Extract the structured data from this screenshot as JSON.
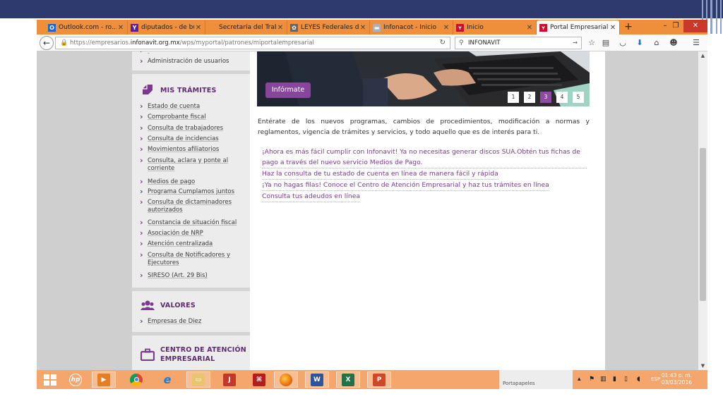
{
  "browser": {
    "tabs": [
      {
        "label": "Outlook.com - ro...",
        "favicon": "outlook-icon",
        "color": "#1e64c8",
        "glyph": "O"
      },
      {
        "label": "diputados - de bú...",
        "favicon": "yahoo-icon",
        "color": "#5a1f9e",
        "glyph": "Y"
      },
      {
        "label": "Secretaría del Trabajo ...",
        "favicon": "none",
        "color": "",
        "glyph": ""
      },
      {
        "label": "LEYES Federales d...",
        "favicon": "seal-icon",
        "color": "#666666",
        "glyph": "✿"
      },
      {
        "label": "Infonacot - Inicio",
        "favicon": "infonacot-icon",
        "color": "#b0b0b0",
        "glyph": "▬"
      },
      {
        "label": "Inicio",
        "favicon": "infonavit-icon",
        "color": "#c8102e",
        "glyph": "ʏ"
      },
      {
        "label": "Portal Empresarial",
        "favicon": "infonavit-icon",
        "color": "#c8102e",
        "glyph": "ʏ",
        "active": true
      }
    ],
    "close_glyph": "✕",
    "new_tab_glyph": "+",
    "window_controls": {
      "minimize": "–",
      "restore": "❐",
      "close": "✕"
    },
    "url_prefix": "https://empresarios.",
    "url_host": "infonavit.org.mx",
    "url_path": "/wps/myportal/patrones/miportalempresarial",
    "search_value": "INFONAVIT"
  },
  "sidebar": {
    "top_item": "Administración de usuarios",
    "tramites_title": "MIS TRÁMITES",
    "tramites": [
      "Estado de cuenta",
      "Comprobante fiscal",
      "Consulta de trabajadores",
      "Consulta de incidencias",
      "Movimientos afiliatorios",
      "Consulta, aclara y ponte al corriente",
      "Medios de pago",
      "Programa Cumplamos juntos",
      "Consulta de dictaminadores autorizados",
      "Constancia de situación fiscal",
      "Asociación de NRP",
      "Atención centralizada",
      "Consulta de Notificadores y Ejecutores",
      "SIRESO (Art. 29 Bis)"
    ],
    "valores_title": "VALORES",
    "valores": [
      "Empresas de Diez"
    ],
    "cae_title": "CENTRO DE ATENCIÓN EMPRESARIAL",
    "accent_color": "#5b2c6f"
  },
  "main": {
    "hero_button": "Infórmate",
    "pager": [
      "1",
      "2",
      "3",
      "4",
      "5"
    ],
    "pager_active": "3",
    "intro": "Entérate de los nuevos programas, cambios de procedimientos, modificación a normas y reglamentos, vigencia de trámites y servicios, y todo aquello que es de interés para ti.",
    "links": [
      "¡Ahora es más fácil cumplir con Infonavit! Ya no necesitas generar discos SUA.Obtén tus fichas de pago a través del nuevo servicio Medios de Pago.",
      "Haz la consulta de tu estado de cuenta en línea de manera fácil y rápida",
      "¡Ya no hagas filas! Conoce el Centro de Atención Empresarial y haz tus trámites en línea",
      "Consulta tus adeudos en línea"
    ],
    "link_color": "#7b3a8e"
  },
  "taskbar": {
    "portapapeles": "Portapapeles",
    "language": "ESP",
    "time": "01:43 p. m.",
    "date": "03/03/2016"
  }
}
